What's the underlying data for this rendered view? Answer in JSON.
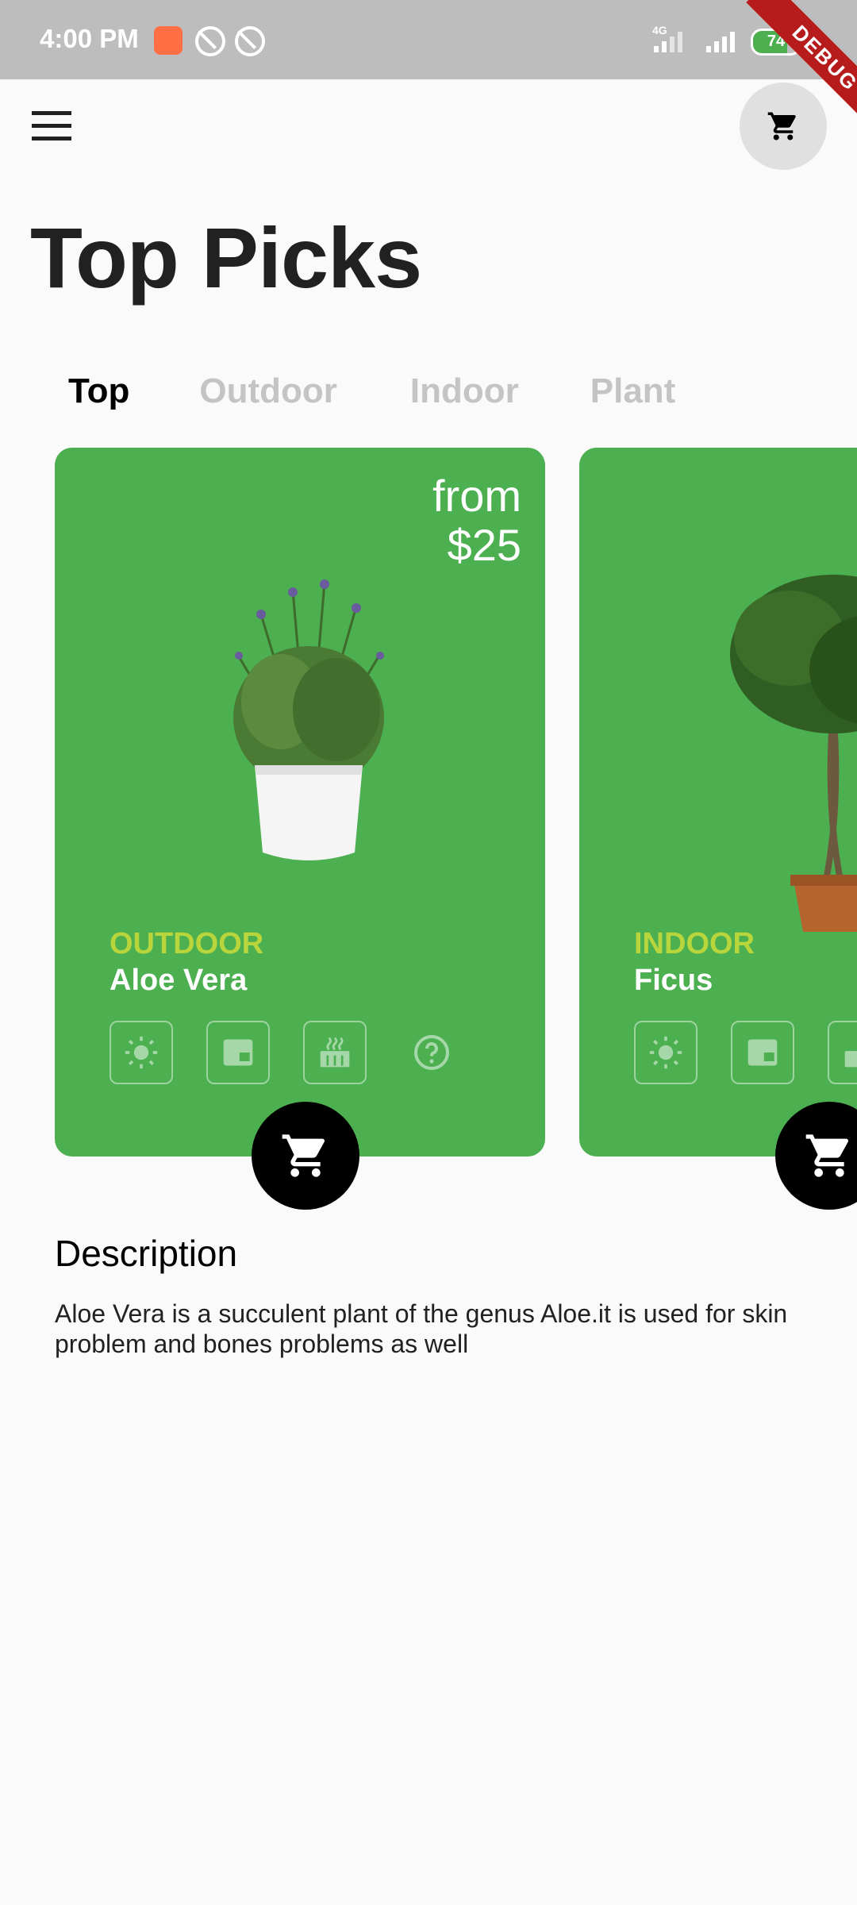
{
  "status_bar": {
    "time": "4:00 PM",
    "network": "4G",
    "battery": "74",
    "battery_level": 0.74
  },
  "debug_banner": "DEBUG",
  "header": {
    "menu_icon": "menu-icon",
    "cart_icon": "cart-icon"
  },
  "title": "Top Picks",
  "tabs": [
    {
      "label": "Top",
      "active": true
    },
    {
      "label": "Outdoor",
      "active": false
    },
    {
      "label": "Indoor",
      "active": false
    },
    {
      "label": "Plant",
      "active": false
    }
  ],
  "cards": [
    {
      "price_prefix": "from",
      "price": "$25",
      "category": "OUTDOOR",
      "name": "Aloe Vera",
      "icons": [
        "sun-icon",
        "window-icon",
        "heater-icon",
        "help-icon"
      ]
    },
    {
      "category": "INDOOR",
      "name": "Ficus",
      "icons": [
        "sun-icon",
        "window-icon",
        "heater-icon"
      ]
    }
  ],
  "colors": {
    "card": "#4caf50",
    "category": "#cddc39",
    "tab_inactive": "#c4c4c4"
  },
  "description": {
    "heading": "Description",
    "text": "Aloe Vera is a succulent plant of the genus Aloe.it is used for skin problem and bones problems as well"
  }
}
